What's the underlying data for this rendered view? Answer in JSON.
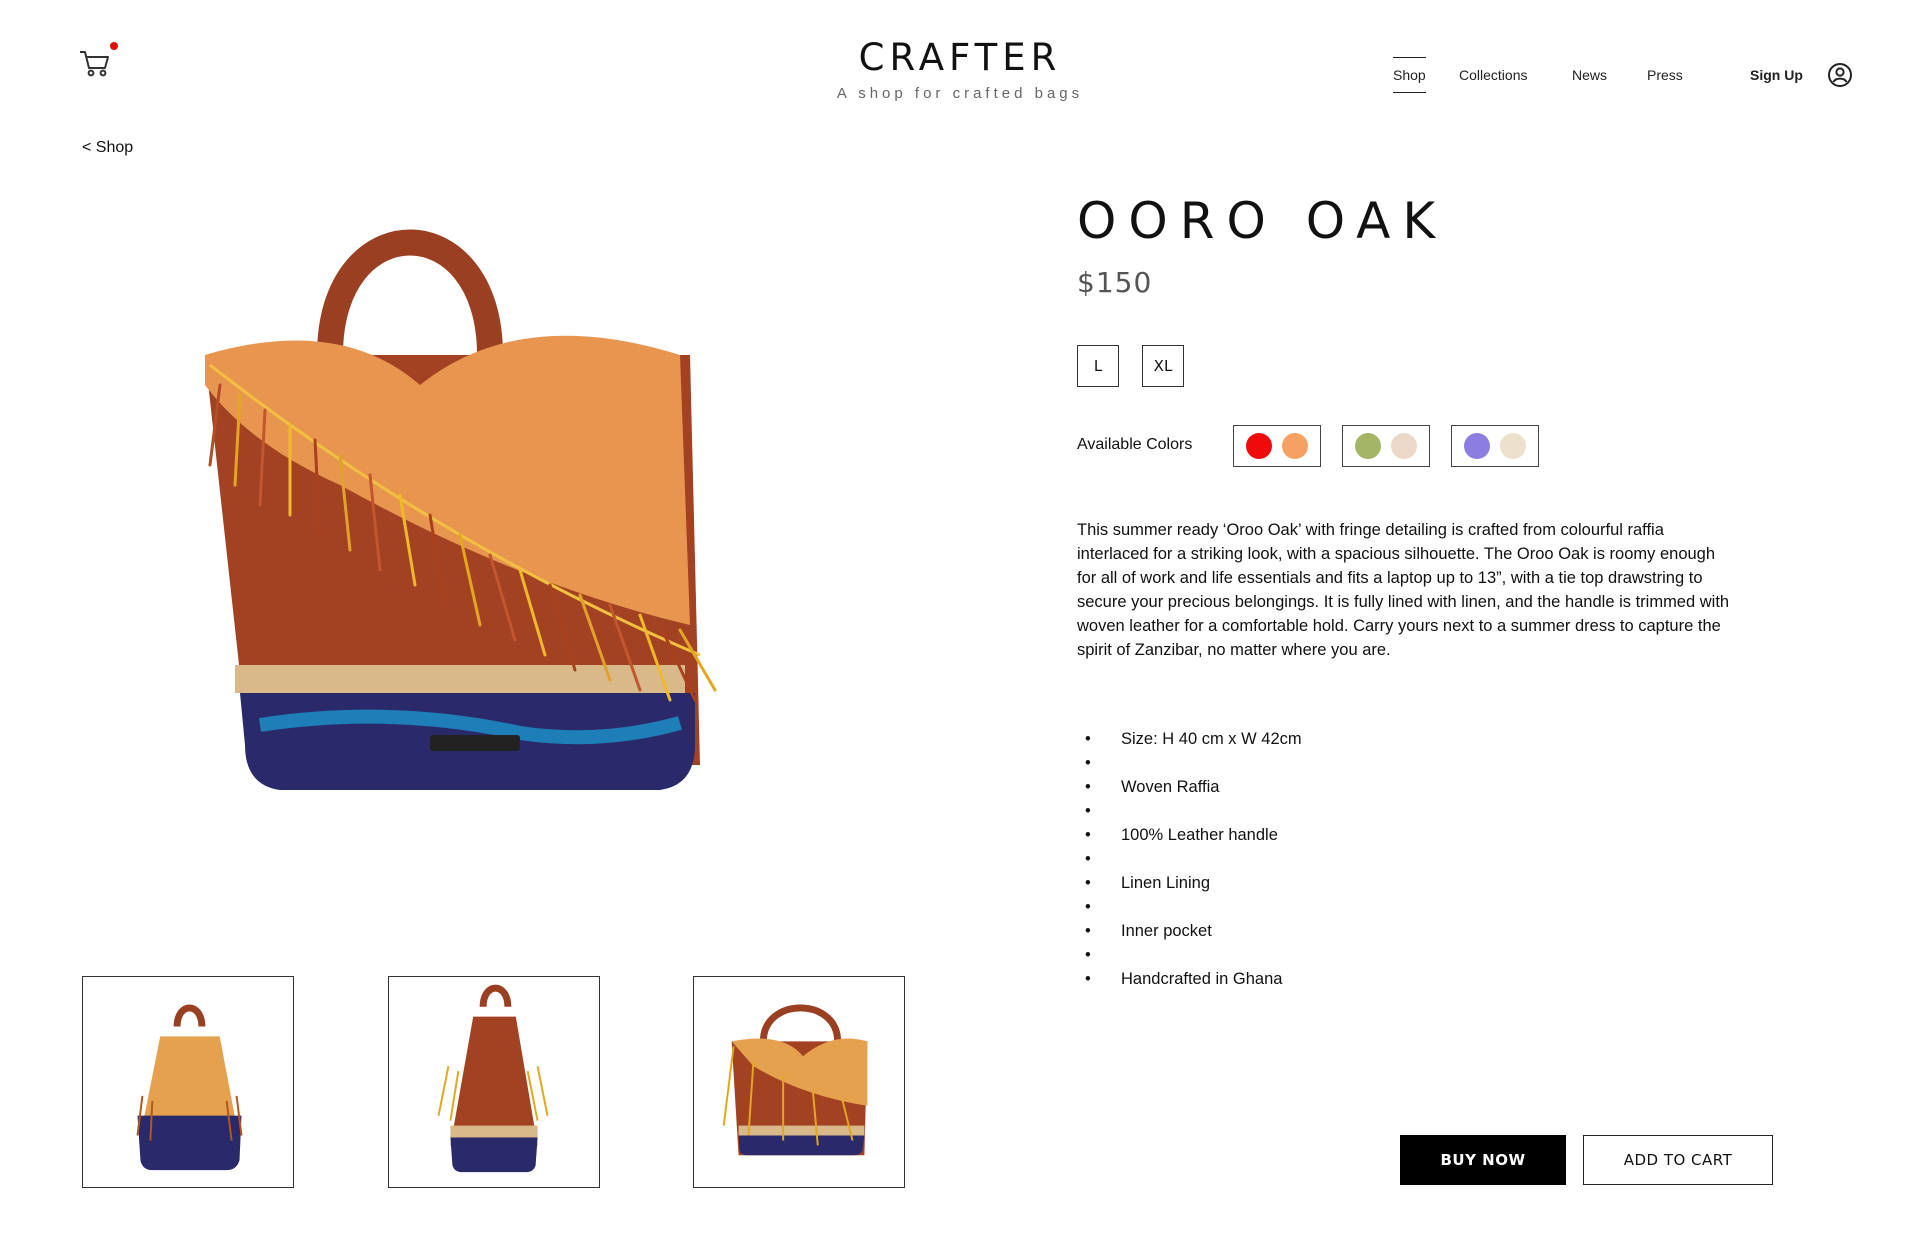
{
  "header": {
    "brand_name": "CRAFTER",
    "tagline": "A shop for crafted bags",
    "nav": [
      {
        "label": "Shop",
        "active": true
      },
      {
        "label": "Collections",
        "active": false
      },
      {
        "label": "News",
        "active": false
      },
      {
        "label": "Press",
        "active": false
      }
    ],
    "sign_up_label": "Sign Up",
    "cart_icon": "cart-icon",
    "user_icon": "user-icon"
  },
  "breadcrumb": {
    "back_label": "< Shop"
  },
  "product": {
    "title": "OORO OAK",
    "price": "$150",
    "sizes": [
      "L",
      "XL"
    ],
    "colors_label": "Available Colors",
    "color_options": [
      {
        "colors": [
          "#f00b0b",
          "#f7a064"
        ]
      },
      {
        "colors": [
          "#a4b567",
          "#ecd8c8"
        ]
      },
      {
        "colors": [
          "#8c7de0",
          "#ebe1cc"
        ]
      }
    ],
    "description": "This summer ready ‘Oroo Oak’ with fringe detailing is crafted from colourful raffia interlaced for a striking look, with a spacious silhouette. The Oroo Oak is roomy enough for all of work and life essentials and fits a laptop up to 13”, with a tie top drawstring to secure your precious belongings. It is fully lined with linen, and the handle is trimmed with woven leather for a comfortable hold. Carry yours next to a summer dress to capture the spirit of Zanzibar, no matter where you are.",
    "features": [
      "Size: H 40 cm x W 42cm",
      "Woven Raffia",
      "100% Leather handle",
      "Linen Lining",
      "Inner pocket",
      "Handcrafted in Ghana"
    ],
    "buy_now_label": "BUY NOW",
    "add_to_cart_label": "ADD TO CART"
  },
  "accent_colors": {
    "cart_badge": "#e10b0b",
    "primary_button": "#000000"
  }
}
